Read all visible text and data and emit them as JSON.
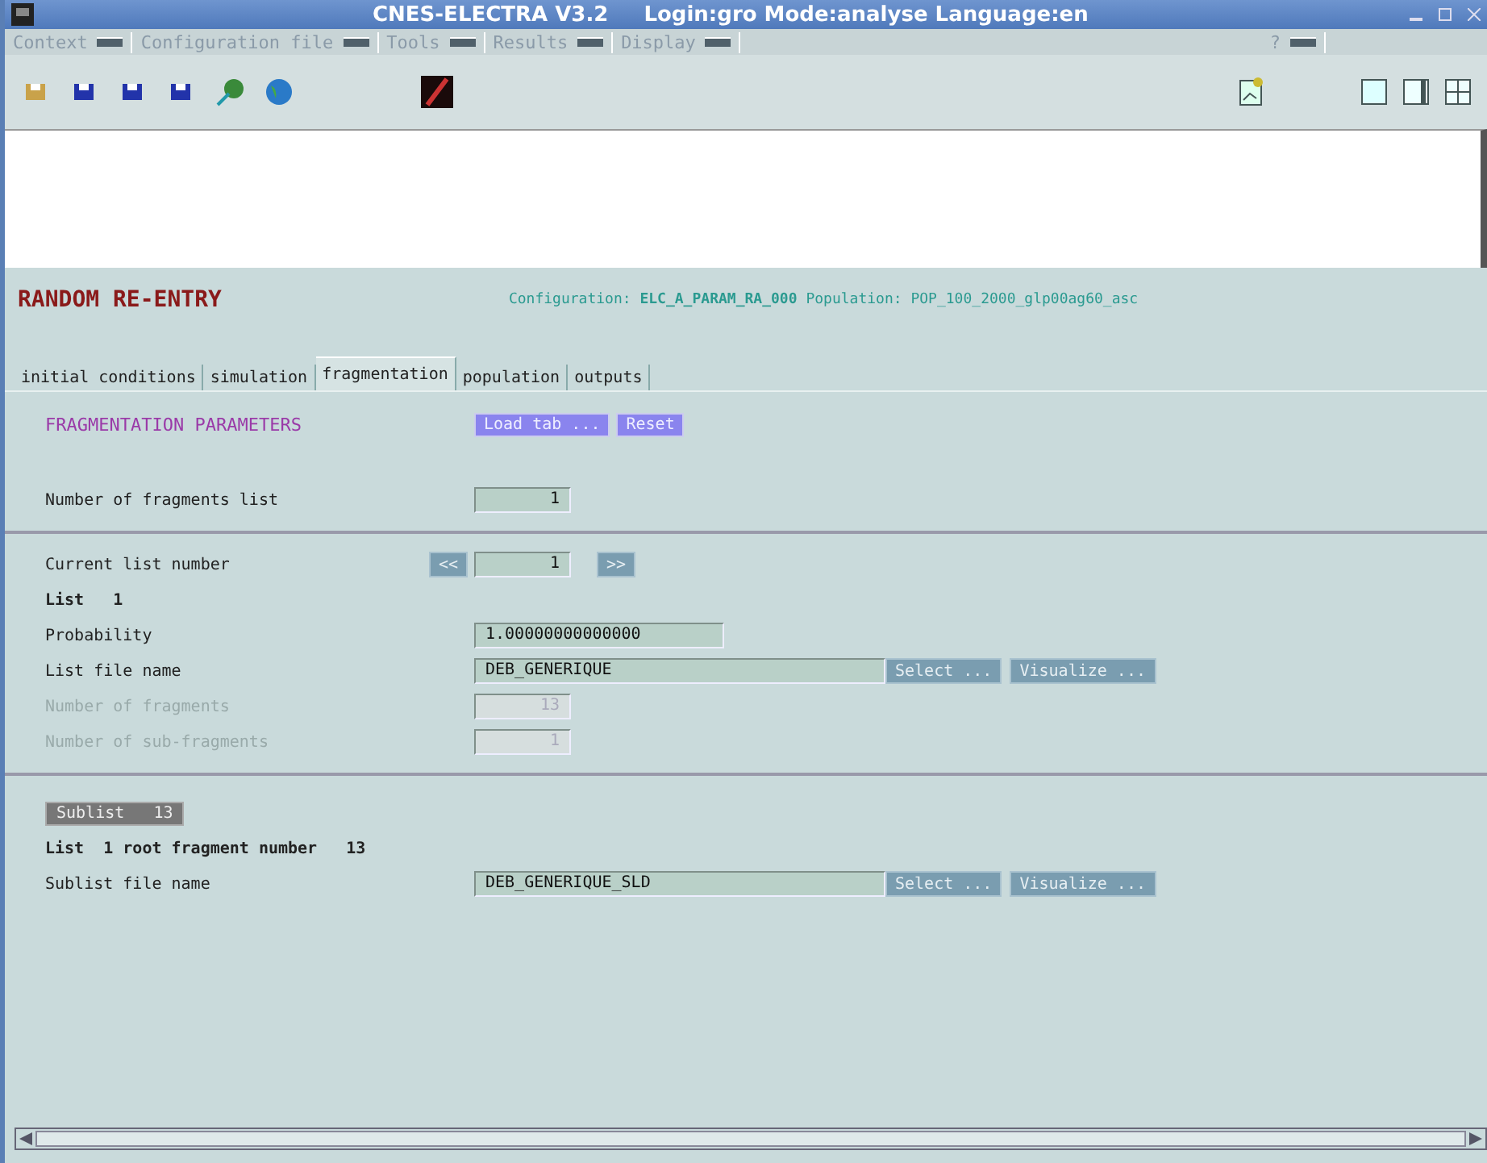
{
  "window": {
    "title": "CNES-ELECTRA V3.2",
    "info": "Login:gro Mode:analyse Language:en"
  },
  "menu": [
    {
      "label": "Context"
    },
    {
      "label": "Configuration file"
    },
    {
      "label": "Tools"
    },
    {
      "label": "Results"
    },
    {
      "label": "Display"
    }
  ],
  "help_menu": {
    "label": "?"
  },
  "header": {
    "title": "RANDOM RE-ENTRY",
    "configuration_label": "Configuration:",
    "configuration": "ELC_A_PARAM_RA_000",
    "population_label": "Population:",
    "population": "POP_100_2000_glp00ag60_asc"
  },
  "tabs": [
    {
      "label": "initial conditions",
      "selected": false
    },
    {
      "label": "simulation",
      "selected": false
    },
    {
      "label": "fragmentation",
      "selected": true
    },
    {
      "label": "population",
      "selected": false
    },
    {
      "label": "outputs",
      "selected": false
    }
  ],
  "panel": {
    "title": "FRAGMENTATION PARAMETERS",
    "buttons": [
      "Load tab ...",
      "Reset"
    ]
  },
  "rows": [
    {
      "kind": "count",
      "label": "Number of fragments list",
      "value": "1",
      "disabled": false
    },
    {
      "kind": "divider"
    },
    {
      "kind": "nav",
      "label": "Current list number",
      "prev": "<<",
      "value": "1",
      "next": ">>"
    },
    {
      "kind": "heading",
      "text": "List",
      "number": "1"
    },
    {
      "kind": "decimal",
      "label": "Probability",
      "value": "1.00000000000000",
      "disabled": false
    },
    {
      "kind": "file",
      "label": "List file name",
      "value": "DEB_GENERIQUE",
      "buttons": [
        "Select ...",
        "Visualize ..."
      ]
    },
    {
      "kind": "count",
      "label": "Number of fragments",
      "value": "13",
      "disabled": true
    },
    {
      "kind": "count",
      "label": "Number of sub-fragments",
      "value": "1",
      "disabled": true
    },
    {
      "kind": "divider"
    },
    {
      "kind": "badge",
      "text": "Sublist",
      "number": "13"
    },
    {
      "kind": "heading",
      "text": "List  1 root fragment number",
      "number": "13"
    },
    {
      "kind": "file",
      "label": "Sublist file name",
      "value": "DEB_GENERIQUE_SLD",
      "buttons": [
        "Select ...",
        "Visualize ..."
      ]
    }
  ]
}
